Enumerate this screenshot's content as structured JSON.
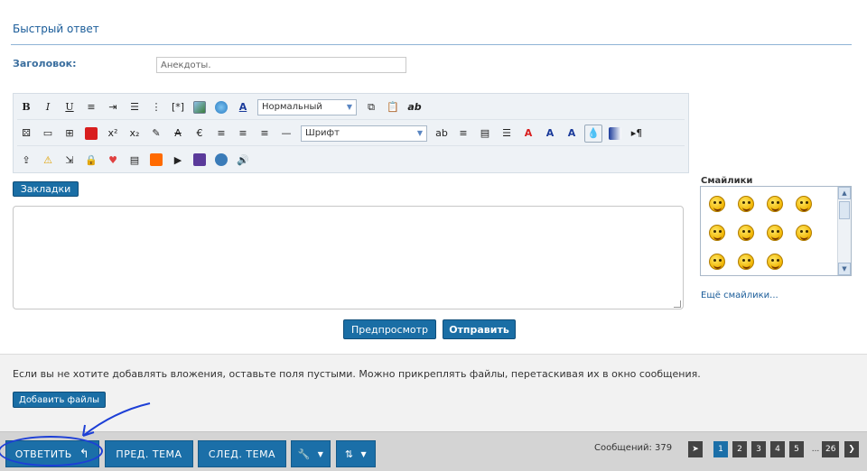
{
  "quick_reply": {
    "title": "Быстрый ответ"
  },
  "subject": {
    "label": "Заголовок:",
    "value": "Анекдоты."
  },
  "toolbar": {
    "format_select": "Нормальный",
    "font_select": "Шрифт"
  },
  "bookmarks_label": "Закладки",
  "editor": {
    "content": ""
  },
  "actions": {
    "preview_label": "Предпросмотр",
    "send_label": "Отправить"
  },
  "smilies": {
    "title": "Смайлики",
    "more_label": "Ещё смайлики..."
  },
  "attachments": {
    "hint": "Если вы не хотите добавлять вложения, оставьте поля пустыми. Можно прикреплять файлы, перетаскивая их в окно сообщения.",
    "button_label": "Добавить файлы"
  },
  "bottom_bar": {
    "reply_label": "ОТВЕТИТЬ",
    "prev_label": "ПРЕД. ТЕМА",
    "next_label": "СЛЕД. ТЕМА",
    "messages_label": "Сообщений: 379",
    "pages": [
      "1",
      "2",
      "3",
      "4",
      "5",
      "...",
      "26"
    ]
  },
  "colors": {
    "accent": "#1b6fa8",
    "annotation": "#1d3fd6"
  }
}
